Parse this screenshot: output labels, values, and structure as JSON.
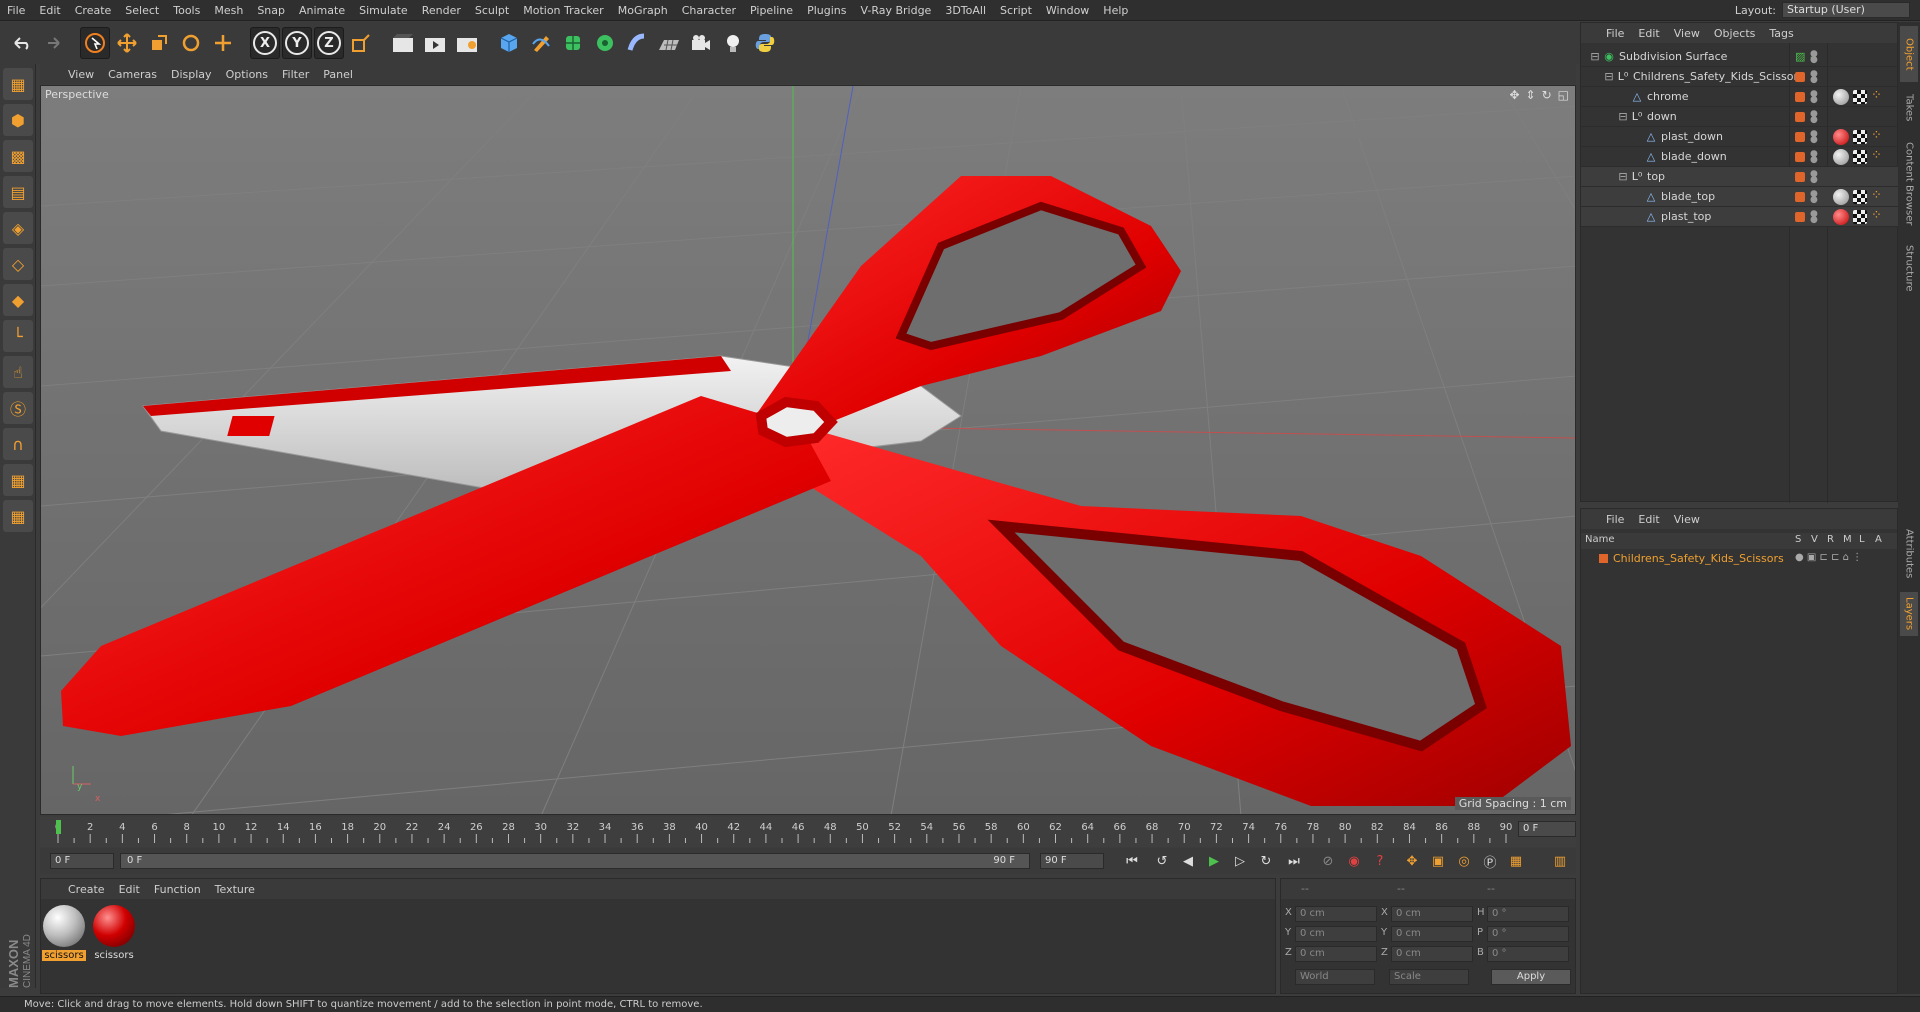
{
  "menubar": {
    "items": [
      "File",
      "Edit",
      "Create",
      "Select",
      "Tools",
      "Mesh",
      "Snap",
      "Animate",
      "Simulate",
      "Render",
      "Sculpt",
      "Motion Tracker",
      "MoGraph",
      "Character",
      "Pipeline",
      "Plugins",
      "V-Ray Bridge",
      "3DToAll",
      "Script",
      "Window",
      "Help"
    ],
    "layout_label": "Layout:",
    "layout_value": "Startup (User)"
  },
  "toolbar": {
    "x_label": "X",
    "y_label": "Y",
    "z_label": "Z"
  },
  "viewport": {
    "menu": [
      "View",
      "Cameras",
      "Display",
      "Options",
      "Filter",
      "Panel"
    ],
    "label": "Perspective",
    "grid_spacing": "Grid Spacing : 1 cm",
    "axis_x": "x",
    "axis_y": "y"
  },
  "timeline": {
    "ticks": [
      "0",
      "2",
      "4",
      "6",
      "8",
      "10",
      "12",
      "14",
      "16",
      "18",
      "20",
      "22",
      "24",
      "26",
      "28",
      "30",
      "32",
      "34",
      "36",
      "38",
      "40",
      "42",
      "44",
      "46",
      "48",
      "50",
      "52",
      "54",
      "56",
      "58",
      "60",
      "62",
      "64",
      "66",
      "68",
      "70",
      "72",
      "74",
      "76",
      "78",
      "80",
      "82",
      "84",
      "86",
      "88",
      "90"
    ],
    "frame_field": "0 F",
    "start_field": "0 F",
    "slider_start": "0 F",
    "slider_end": "90 F",
    "end_field": "90 F"
  },
  "material_manager": {
    "menu": [
      "Create",
      "Edit",
      "Function",
      "Texture"
    ],
    "materials": [
      {
        "name": "scissors",
        "color": "#bdbdbd"
      },
      {
        "name": "scissors",
        "color": "#d00000"
      }
    ]
  },
  "coordinates": {
    "header_a": "--",
    "header_b": "--",
    "header_c": "--",
    "rows": [
      {
        "a_label": "X",
        "a_val": "0 cm",
        "b_label": "X",
        "b_val": "0 cm",
        "c_label": "H",
        "c_val": "0 °"
      },
      {
        "a_label": "Y",
        "a_val": "0 cm",
        "b_label": "Y",
        "b_val": "0 cm",
        "c_label": "P",
        "c_val": "0 °"
      },
      {
        "a_label": "Z",
        "a_val": "0 cm",
        "b_label": "Z",
        "b_val": "0 cm",
        "c_label": "B",
        "c_val": "0 °"
      }
    ],
    "world": "World",
    "scale": "Scale",
    "apply": "Apply"
  },
  "object_manager": {
    "menu": [
      "File",
      "Edit",
      "View",
      "Objects",
      "Tags"
    ],
    "objects": [
      {
        "name": "Subdivision Surface",
        "indent": 0,
        "icon": "subdivision-icon",
        "tag": ""
      },
      {
        "name": "Childrens_Safety_Kids_Scissors",
        "indent": 1,
        "icon": "null-icon",
        "tag": ""
      },
      {
        "name": "chrome",
        "indent": 2,
        "icon": "polygon-icon",
        "tag": "gray"
      },
      {
        "name": "down",
        "indent": 2,
        "icon": "null-icon",
        "tag": ""
      },
      {
        "name": "plast_down",
        "indent": 3,
        "icon": "polygon-icon",
        "tag": "red"
      },
      {
        "name": "blade_down",
        "indent": 3,
        "icon": "polygon-icon",
        "tag": "gray"
      },
      {
        "name": "top",
        "indent": 2,
        "icon": "null-icon",
        "tag": ""
      },
      {
        "name": "blade_top",
        "indent": 3,
        "icon": "polygon-icon",
        "tag": "gray"
      },
      {
        "name": "plast_top",
        "indent": 3,
        "icon": "polygon-icon",
        "tag": "red"
      }
    ]
  },
  "layer_manager": {
    "menu": [
      "File",
      "Edit",
      "View"
    ],
    "columns": {
      "name": "Name",
      "s": "S",
      "v": "V",
      "r": "R",
      "m": "M",
      "l": "L",
      "a": "A"
    },
    "layers": [
      {
        "name": "Childrens_Safety_Kids_Scissors",
        "color": "#e0652a"
      }
    ]
  },
  "side_tabs": [
    "Object",
    "Takes",
    "Content Browser",
    "Structure",
    "Attributes",
    "Layers"
  ],
  "status": {
    "text": "Move: Click and drag to move elements. Hold down SHIFT to quantize movement / add to the selection in point mode, CTRL to remove."
  },
  "colors": {
    "scissors_red": "#e00000",
    "blade_silver": "#d8d8d8",
    "accent_orange": "#f0a030"
  }
}
